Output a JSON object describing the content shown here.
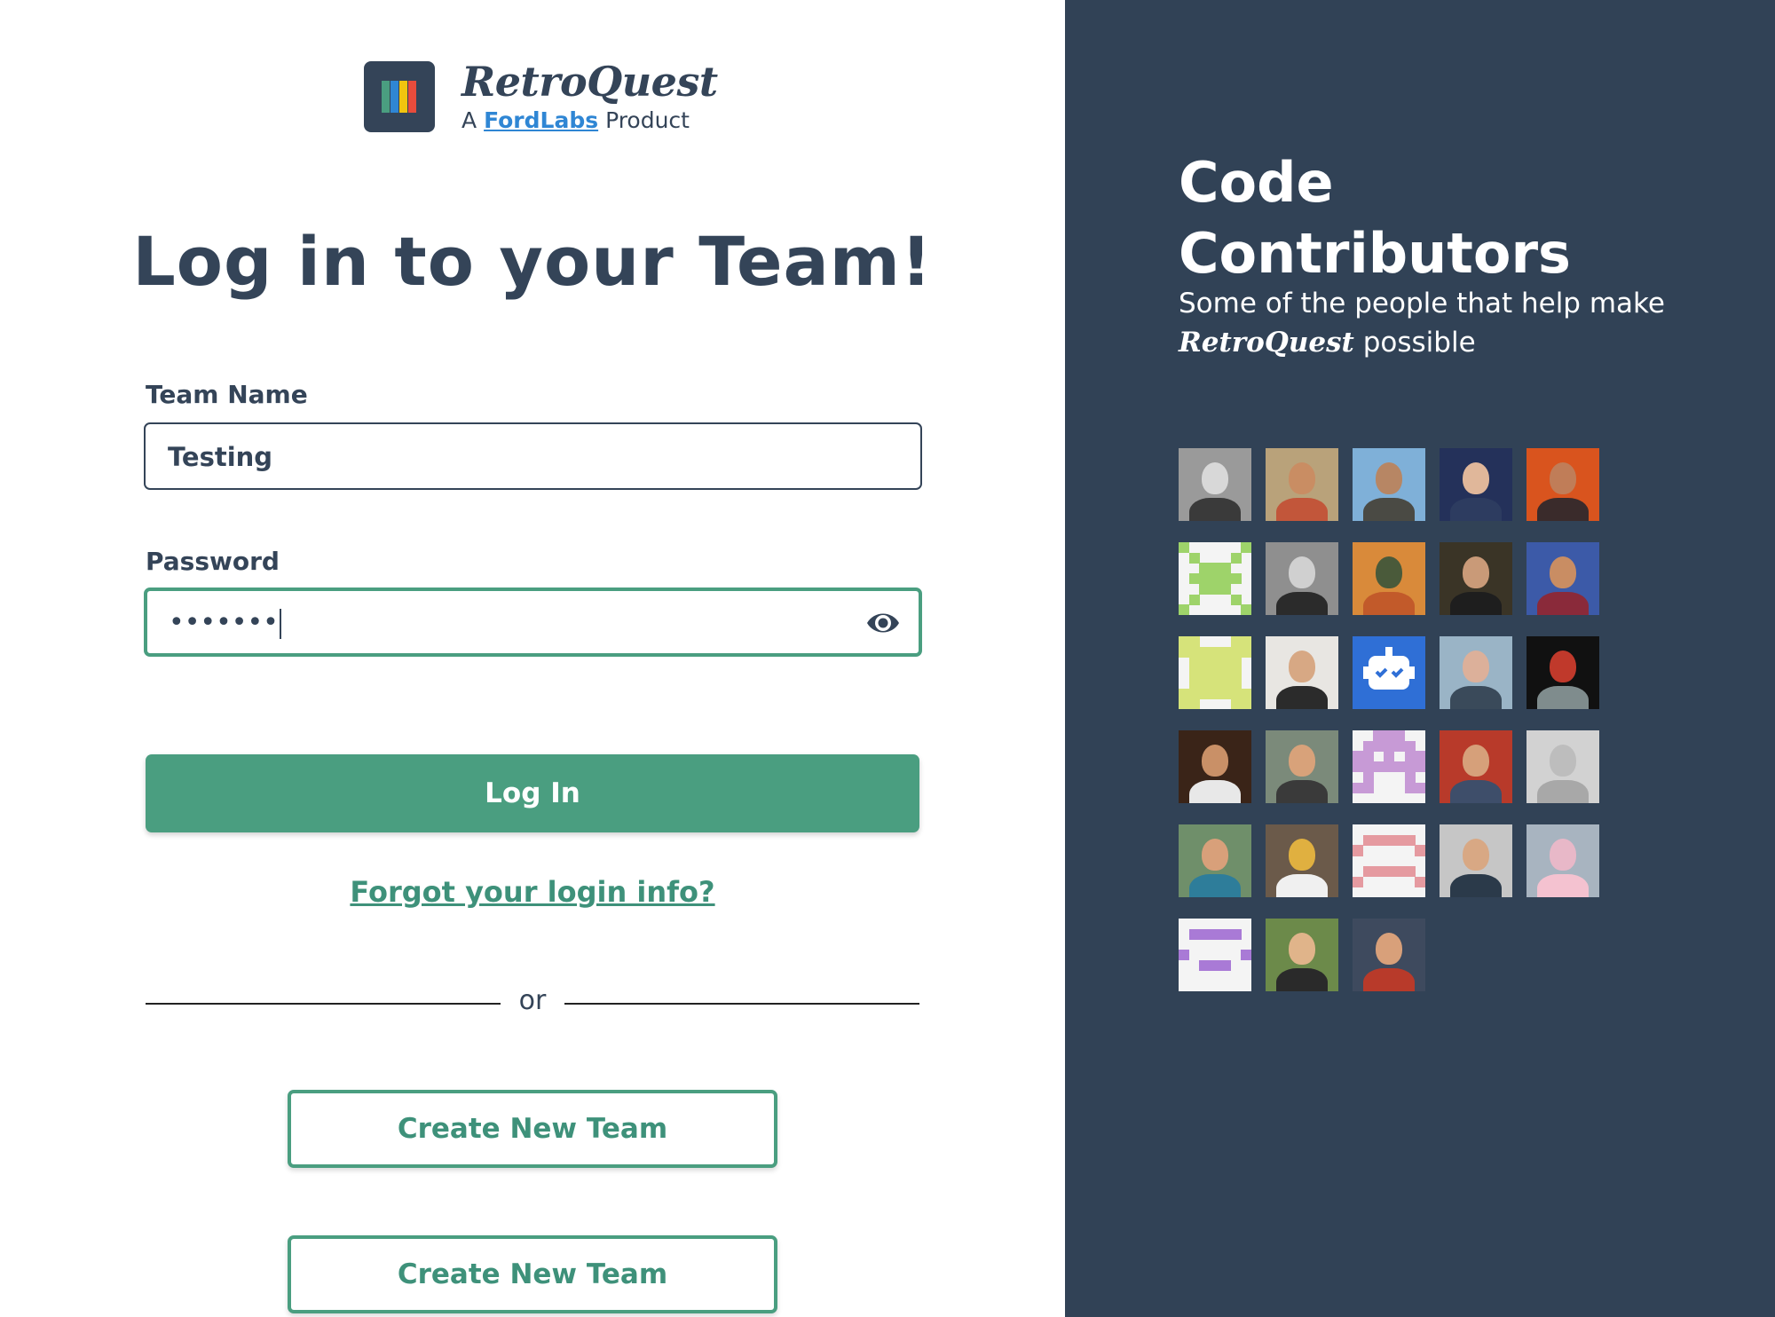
{
  "brand": {
    "name": "RetroQuest",
    "sub_prefix": "A",
    "sub_link": "FordLabs",
    "sub_suffix": "Product",
    "logo_colors": [
      "#4a9e80",
      "#2f86d4",
      "#f1c40f",
      "#e74c3c"
    ]
  },
  "login": {
    "heading": "Log in to your Team!",
    "team_label": "Team Name",
    "team_value": "Testing",
    "password_label": "Password",
    "password_value": "•••••••",
    "login_button": "Log In",
    "forgot_link": "Forgot your login info?",
    "or_text": "or",
    "create_buttons": [
      "Create New Team",
      "Create New Team"
    ]
  },
  "contributors": {
    "title": "Code Contributors",
    "subtitle_line1": "Some of the people that help make",
    "subtitle_brand": "RetroQuest",
    "subtitle_end": "possible",
    "avatars": [
      {
        "kind": "photo",
        "bg": "#9a9a9a",
        "skin": "#d8d8d8",
        "shirt": "#3a3a3a"
      },
      {
        "kind": "photo",
        "bg": "#b9a27a",
        "skin": "#c98d63",
        "shirt": "#c2563a"
      },
      {
        "kind": "photo",
        "bg": "#7fb0d8",
        "skin": "#b78664",
        "shirt": "#4a4a44"
      },
      {
        "kind": "photo",
        "bg": "#24315a",
        "skin": "#e0b79a",
        "shirt": "#2d3c60"
      },
      {
        "kind": "photo",
        "bg": "#d9541e",
        "skin": "#c07d58",
        "shirt": "#3a2b2b"
      },
      {
        "kind": "pixel",
        "color": "#9ed36a",
        "pattern": "x"
      },
      {
        "kind": "photo",
        "bg": "#8f8f8f",
        "skin": "#d0d0d0",
        "shirt": "#2b2b2b"
      },
      {
        "kind": "photo",
        "bg": "#d98a3a",
        "skin": "#4a5a3a",
        "shirt": "#c25a2a"
      },
      {
        "kind": "photo",
        "bg": "#3a3426",
        "skin": "#c99a78",
        "shirt": "#1e1e1e"
      },
      {
        "kind": "photo",
        "bg": "#3c5aa8",
        "skin": "#c98d63",
        "shirt": "#8a2a3a"
      },
      {
        "kind": "pixel",
        "color": "#d6e37a",
        "pattern": "h"
      },
      {
        "kind": "photo",
        "bg": "#e8e6e2",
        "skin": "#d7a884",
        "shirt": "#2b2b2b"
      },
      {
        "kind": "robot",
        "bg": "#2f6fd6"
      },
      {
        "kind": "photo",
        "bg": "#9ab4c6",
        "skin": "#dcb09a",
        "shirt": "#3a4a5a"
      },
      {
        "kind": "photo",
        "bg": "#111111",
        "skin": "#c0392b",
        "shirt": "#7f8c8d"
      },
      {
        "kind": "photo",
        "bg": "#3a2418",
        "skin": "#c99067",
        "shirt": "#e8e8e8"
      },
      {
        "kind": "photo",
        "bg": "#7b8a7a",
        "skin": "#d8a27a",
        "shirt": "#3a3a3a"
      },
      {
        "kind": "pixel",
        "color": "#c79ad6",
        "pattern": "space"
      },
      {
        "kind": "photo",
        "bg": "#b83a2a",
        "skin": "#d6a07a",
        "shirt": "#3e4e6a"
      },
      {
        "kind": "photo",
        "bg": "#d2d2d2",
        "skin": "#bdbdbd",
        "shirt": "#a8a8a8"
      },
      {
        "kind": "photo",
        "bg": "#6f8f6a",
        "skin": "#d8a07a",
        "shirt": "#2e7d9a"
      },
      {
        "kind": "photo",
        "bg": "#6b5a4a",
        "skin": "#e0b040",
        "shirt": "#f0f0f0"
      },
      {
        "kind": "pixel",
        "color": "#e59aa0",
        "pattern": "frown"
      },
      {
        "kind": "photo",
        "bg": "#c6c6c6",
        "skin": "#d8a884",
        "shirt": "#2b3a4a"
      },
      {
        "kind": "photo",
        "bg": "#a8b4c0",
        "skin": "#e8b8c8",
        "shirt": "#f4c2d0"
      },
      {
        "kind": "pixel",
        "color": "#a97ad6",
        "pattern": "face"
      },
      {
        "kind": "photo",
        "bg": "#6c8a4a",
        "skin": "#e0b48a",
        "shirt": "#2a2a2a"
      },
      {
        "kind": "photo",
        "bg": "#3e4a5e",
        "skin": "#d8a07a",
        "shirt": "#b83a2a"
      }
    ]
  }
}
